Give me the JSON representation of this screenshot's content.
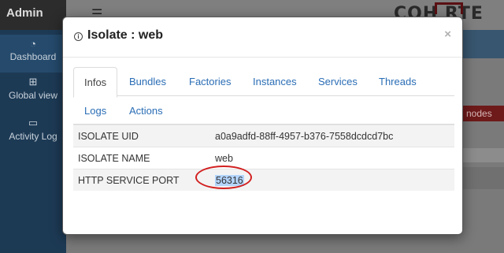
{
  "app": {
    "brand": "Admin",
    "logo_text": "COH   RTE"
  },
  "sidebar": {
    "items": [
      {
        "label": "Dashboard",
        "icon": "dashboard-icon"
      },
      {
        "label": "Global view",
        "icon": "sitemap-icon"
      },
      {
        "label": "Activity Log",
        "icon": "monitor-icon"
      }
    ]
  },
  "background": {
    "nodes_button": "nodes"
  },
  "modal": {
    "title": "Isolate : web",
    "close": "×",
    "tabs": [
      {
        "label": "Infos",
        "active": true
      },
      {
        "label": "Bundles"
      },
      {
        "label": "Factories"
      },
      {
        "label": "Instances"
      },
      {
        "label": "Services"
      },
      {
        "label": "Threads"
      },
      {
        "label": "Logs"
      },
      {
        "label": "Actions"
      }
    ],
    "rows": [
      {
        "key": "ISOLATE UID",
        "value": "a0a9adfd-88ff-4957-b376-7558dcdcd7bc"
      },
      {
        "key": "ISOLATE NAME",
        "value": "web"
      },
      {
        "key": "HTTP SERVICE PORT",
        "value": "56316"
      }
    ]
  },
  "colors": {
    "link": "#2a6db5",
    "selection": "#b3d4fc",
    "annotation": "#d21f1f"
  }
}
